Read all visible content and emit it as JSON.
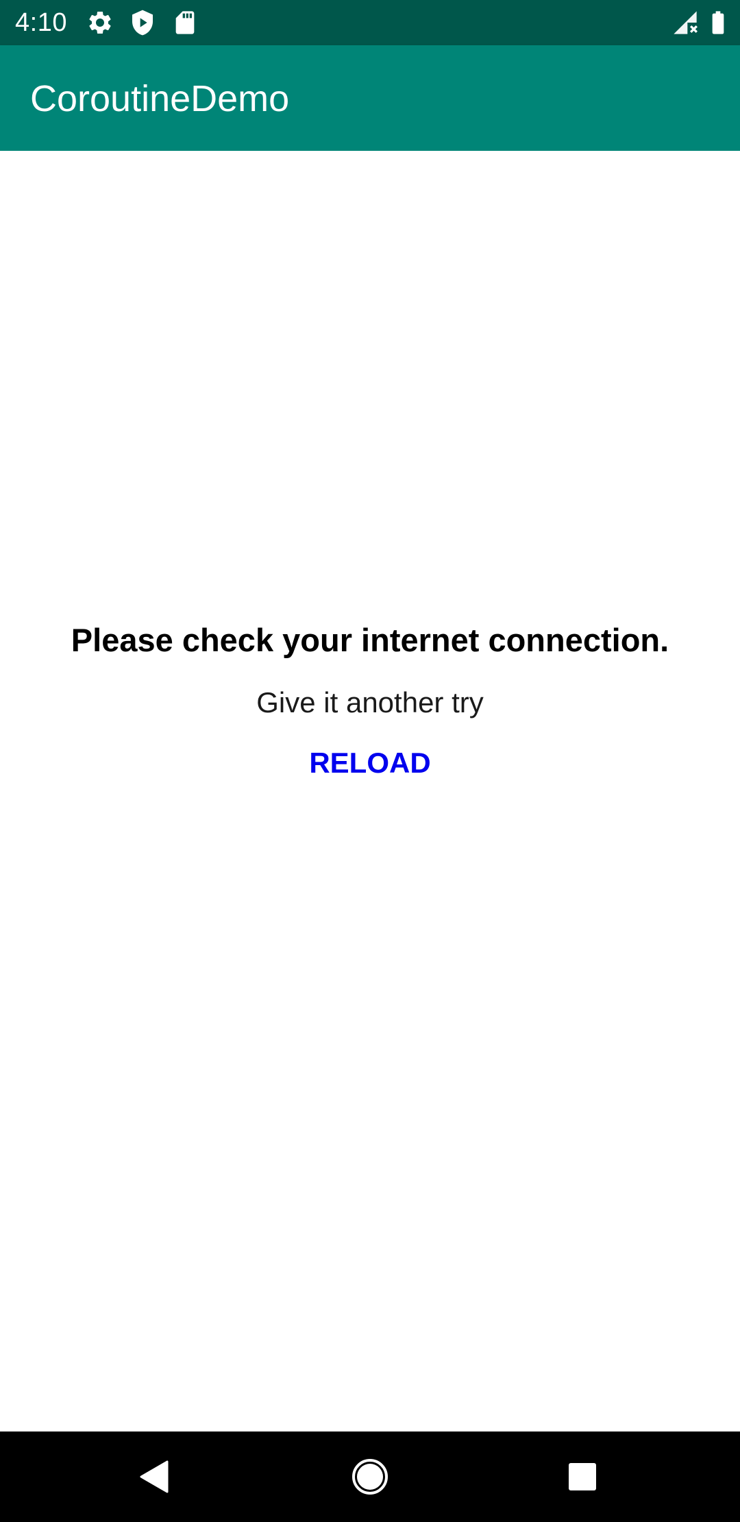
{
  "status_bar": {
    "time": "4:10",
    "icons_left": [
      "settings-icon",
      "shield-play-icon",
      "sd-card-icon"
    ],
    "icons_right": [
      "signal-no-data-icon",
      "battery-icon"
    ],
    "background": "#00574b"
  },
  "app_bar": {
    "title": "CoroutineDemo",
    "background": "#008577"
  },
  "error": {
    "title": "Please check your internet connection.",
    "subtitle": "Give it another try",
    "reload_label": "RELOAD",
    "reload_color": "#0000ee"
  },
  "nav_bar": {
    "buttons": [
      "back-icon",
      "home-icon",
      "recents-icon"
    ],
    "background": "#000000"
  }
}
